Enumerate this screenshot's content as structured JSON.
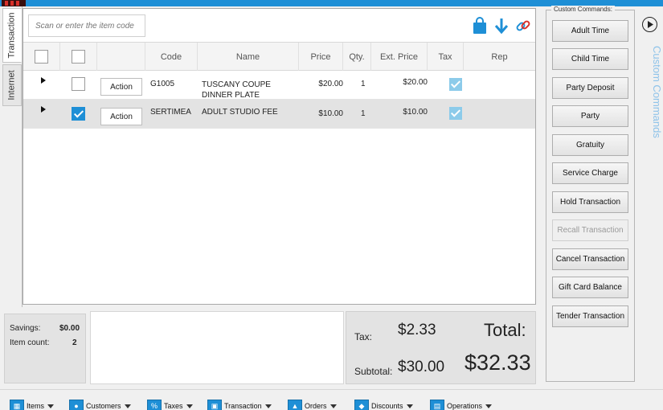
{
  "side_tabs": [
    "Transaction",
    "Internet"
  ],
  "scan_placeholder": "Scan or enter the item code",
  "toolbar_icons": [
    "shopping-bag-icon",
    "download-arrow-icon",
    "link-icon"
  ],
  "grid": {
    "columns": [
      "Code",
      "Name",
      "Price",
      "Qty.",
      "Ext. Price",
      "Tax",
      "Rep"
    ],
    "rows": [
      {
        "action": "Action",
        "code": "G1005",
        "name": "TUSCANY COUPE DINNER PLATE",
        "price": "$20.00",
        "qty": "1",
        "ext_price": "$20.00",
        "selected": false,
        "tax": true
      },
      {
        "action": "Action",
        "code": "SERTIMEA",
        "name": "ADULT STUDIO FEE",
        "price": "$10.00",
        "qty": "1",
        "ext_price": "$10.00",
        "selected": true,
        "tax": true
      }
    ]
  },
  "summary": {
    "savings_label": "Savings:",
    "savings_value": "$0.00",
    "item_count_label": "Item count:",
    "item_count_value": "2",
    "tax_label": "Tax:",
    "tax_value": "$2.33",
    "subtotal_label": "Subtotal:",
    "subtotal_value": "$30.00",
    "total_label": "Total:",
    "total_value": "$32.33"
  },
  "custom_commands": {
    "legend": "Custom Commands:",
    "side_label": "Custom Commands",
    "buttons": [
      {
        "label": "Adult Time",
        "enabled": true
      },
      {
        "label": "Child Time",
        "enabled": true
      },
      {
        "label": "Party Deposit",
        "enabled": true
      },
      {
        "label": "Party",
        "enabled": true
      },
      {
        "label": "Gratuity",
        "enabled": true
      },
      {
        "label": "Service Charge",
        "enabled": true
      },
      {
        "label": "Hold Transaction",
        "enabled": true
      },
      {
        "label": "Recall Transaction",
        "enabled": false
      },
      {
        "label": "Cancel Transaction",
        "enabled": true
      },
      {
        "label": "Gift Card Balance",
        "enabled": true
      },
      {
        "label": "Tender Transaction",
        "enabled": true
      }
    ]
  },
  "bottom_menus": [
    "Items",
    "Customers",
    "Taxes",
    "Transaction",
    "Orders",
    "Discounts",
    "Operations"
  ],
  "colors": {
    "accent": "#1e8fd6",
    "tax_check": "#8ccbea",
    "selected_row": "#e3e3e3"
  }
}
